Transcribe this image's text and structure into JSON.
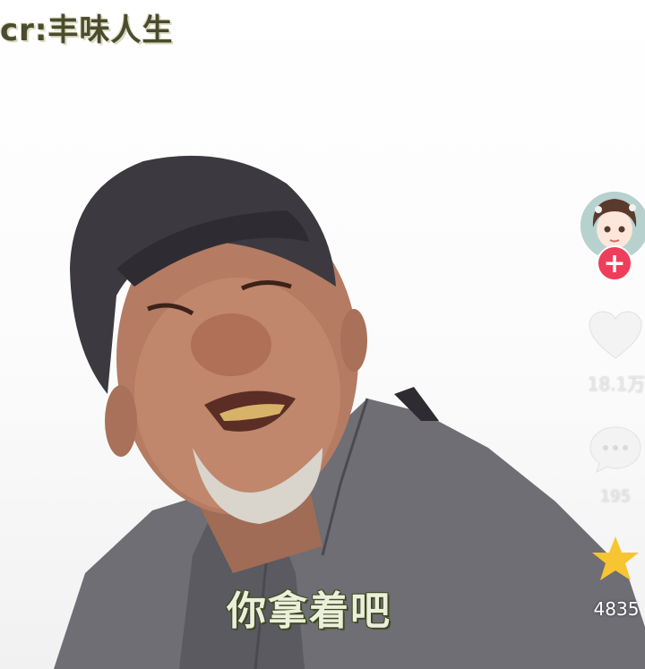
{
  "watermark": "cr:丰味人生",
  "subtitle": "你拿着吧",
  "creator": {
    "avatar_icon": "anime-girl-avatar",
    "follow_label": "+"
  },
  "actions": {
    "like": {
      "icon": "heart-icon",
      "count": "18.1万"
    },
    "comment": {
      "icon": "comment-icon",
      "count": "195"
    },
    "favorite": {
      "icon": "star-icon",
      "count": "4835",
      "color": "#f7c531"
    }
  },
  "colors": {
    "follow_button": "#ef3e5b",
    "star": "#f7c531",
    "jacket": "#6e6e74",
    "cap": "#3c3a40"
  }
}
